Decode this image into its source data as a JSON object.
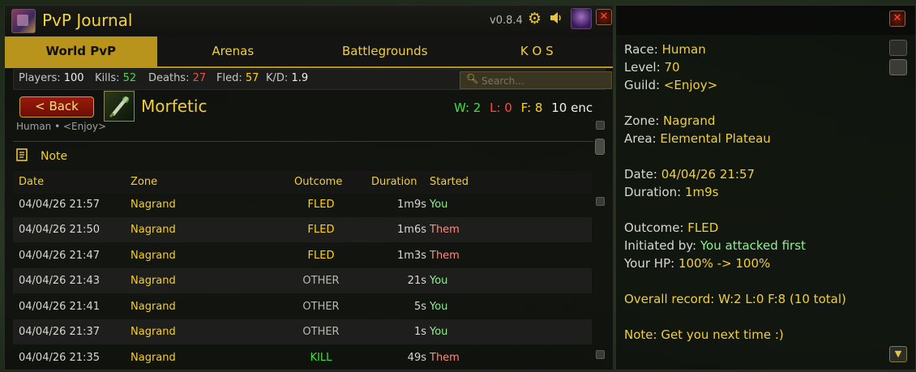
{
  "window": {
    "title": "PvP Journal",
    "version": "v0.8.4"
  },
  "tabs": [
    {
      "label": "World PvP",
      "active": true
    },
    {
      "label": "Arenas",
      "active": false
    },
    {
      "label": "Battlegrounds",
      "active": false
    },
    {
      "label": "K O S",
      "active": false
    }
  ],
  "stats": {
    "players_label": "Players:",
    "players": "100",
    "kills_label": "Kills:",
    "kills": "52",
    "deaths_label": "Deaths:",
    "deaths": "27",
    "fled_label": "Fled:",
    "fled": "57",
    "kd_label": "K/D:",
    "kd": "1.9"
  },
  "search": {
    "placeholder": "Search..."
  },
  "player": {
    "back_label": "< Back",
    "name": "Morfetic",
    "subtitle": "Human • <Enjoy>",
    "record_w": "W: 2",
    "record_l": "L: 0",
    "record_f": "F: 8",
    "record_enc": "10 enc"
  },
  "note": {
    "label": "Note"
  },
  "table": {
    "headers": {
      "date": "Date",
      "zone": "Zone",
      "outcome": "Outcome",
      "duration": "Duration",
      "started": "Started"
    },
    "rows": [
      {
        "date": "04/04/26 21:57",
        "zone": "Nagrand",
        "outcome": "FLED",
        "duration": "1m9s",
        "started": "You"
      },
      {
        "date": "04/04/26 21:50",
        "zone": "Nagrand",
        "outcome": "FLED",
        "duration": "1m6s",
        "started": "Them"
      },
      {
        "date": "04/04/26 21:47",
        "zone": "Nagrand",
        "outcome": "FLED",
        "duration": "1m3s",
        "started": "Them"
      },
      {
        "date": "04/04/26 21:43",
        "zone": "Nagrand",
        "outcome": "OTHER",
        "duration": "21s",
        "started": "You"
      },
      {
        "date": "04/04/26 21:41",
        "zone": "Nagrand",
        "outcome": "OTHER",
        "duration": "5s",
        "started": "You"
      },
      {
        "date": "04/04/26 21:37",
        "zone": "Nagrand",
        "outcome": "OTHER",
        "duration": "1s",
        "started": "You"
      },
      {
        "date": "04/04/26 21:35",
        "zone": "Nagrand",
        "outcome": "KILL",
        "duration": "49s",
        "started": "Them"
      }
    ]
  },
  "detail": {
    "race_label": "Race:",
    "race": "Human",
    "level_label": "Level:",
    "level": "70",
    "guild_label": "Guild:",
    "guild": "<Enjoy>",
    "zone_label": "Zone:",
    "zone": "Nagrand",
    "area_label": "Area:",
    "area": "Elemental Plateau",
    "date_label": "Date:",
    "date": "04/04/26 21:57",
    "duration_label": "Duration:",
    "duration": "1m9s",
    "outcome_label": "Outcome:",
    "outcome": "FLED",
    "initiated_label": "Initiated by:",
    "initiated": "You attacked first",
    "hp_label": "Your HP:",
    "hp": "100% -> 100%",
    "overall": "Overall record: W:2 L:0 F:8 (10 total)",
    "note": "Note: Get you next time :)"
  },
  "colors": {
    "accent_gold": "#f0cf3a",
    "win_green": "#3ee03e",
    "loss_red": "#ff4a3a"
  }
}
